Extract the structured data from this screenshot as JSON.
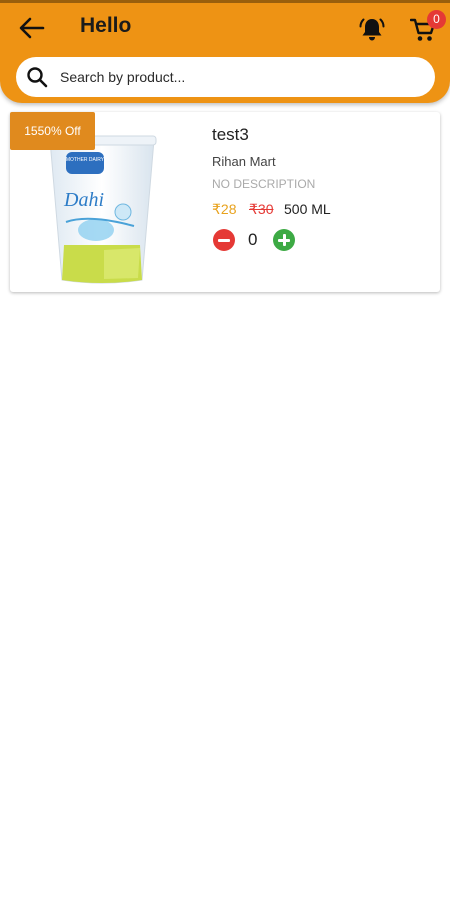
{
  "header": {
    "title": "Hello",
    "back_icon": "arrow-left-icon",
    "bell_icon": "bell-ring-icon",
    "cart_icon": "cart-icon",
    "cart_count": "0",
    "background_color": "#EE9314"
  },
  "search": {
    "placeholder": "Search by product...",
    "value": "",
    "icon": "search-icon"
  },
  "products": [
    {
      "discount": "1550% Off",
      "name": "test3",
      "store": "Rihan Mart",
      "description": "NO DESCRIPTION",
      "price": "₹28",
      "original_price": "₹30",
      "unit": "500 ML",
      "quantity": "0",
      "image_text": {
        "brand": "MOTHER DAIRY",
        "name": "Dahi"
      }
    }
  ],
  "colors": {
    "accent": "#EE9314",
    "badge": "#E08A1E",
    "price": "#E8A21D",
    "strike": "#E53935",
    "minus": "#E53935",
    "plus": "#3DAA44"
  }
}
